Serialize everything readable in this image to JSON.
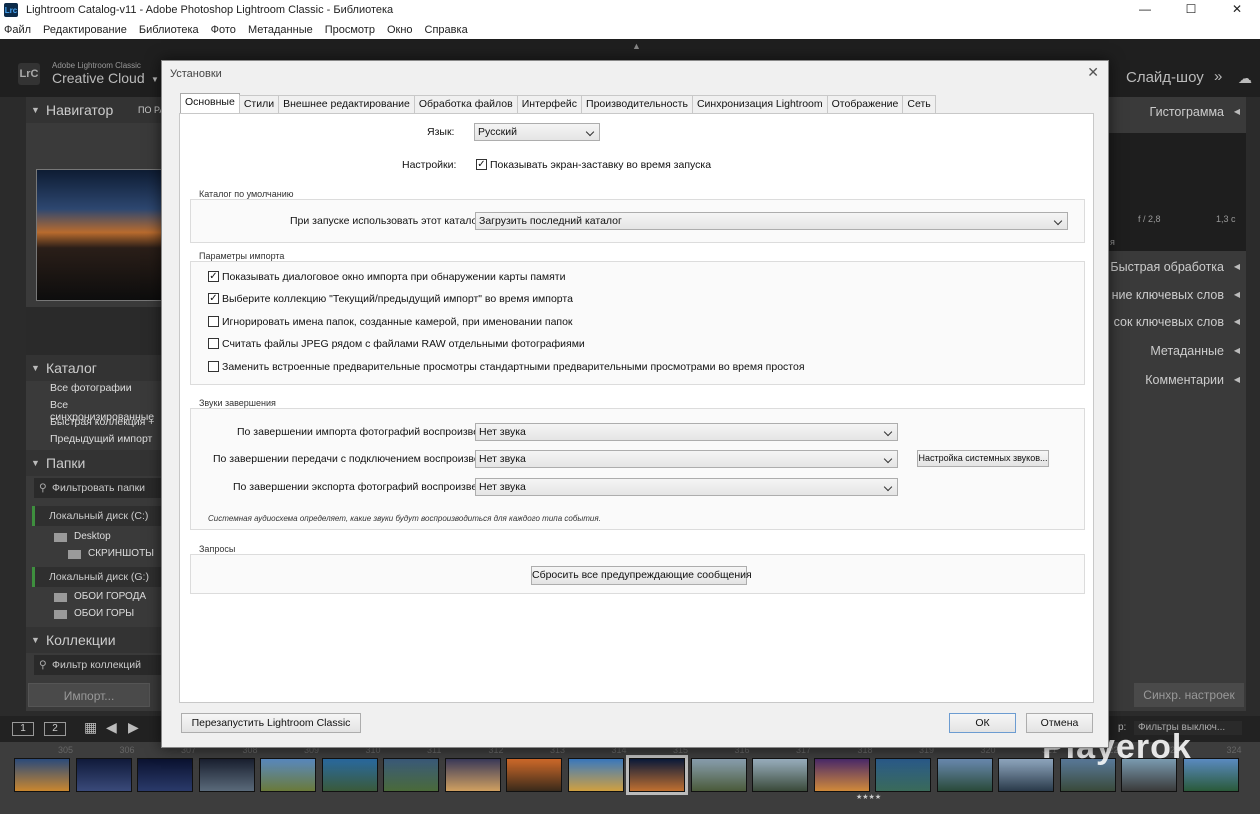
{
  "window": {
    "title": "Lightroom Catalog-v11 - Adobe Photoshop Lightroom Classic - Библиотека",
    "app_icon": "Lrc",
    "controls": [
      "—",
      "☐",
      "✕"
    ]
  },
  "menu": [
    "Файл",
    "Редактирование",
    "Библиотека",
    "Фото",
    "Метаданные",
    "Просмотр",
    "Окно",
    "Справка"
  ],
  "lr": {
    "logo": "LrC",
    "brand_small": "Adobe Lightroom Classic",
    "brand_big": "Creative Cloud",
    "module": "Слайд-шоу",
    "module_arrow": "»"
  },
  "left_panel": {
    "navigator": "Навигатор",
    "navigator_fit": "ПО РА",
    "catalog": "Каталог",
    "catalog_items": [
      "Все фотографии",
      "Все синхронизированные",
      "Быстрая коллекция  +",
      "Предыдущий импорт"
    ],
    "folders": "Папки",
    "folders_filter": "Фильтровать папки",
    "drive_c": "Локальный диск (C:)",
    "desktop": "Desktop",
    "screenshots": "СКРИНШОТЫ",
    "drive_g": "Локальный диск (G:)",
    "city": "ОБОИ ГОРОДА",
    "mountains": "ОБОИ ГОРЫ",
    "collections": "Коллекции",
    "collections_filter": "Фильтр коллекций",
    "import_btn": "Импорт..."
  },
  "right_panel": {
    "histogram": "Гистограмма",
    "aperture": "f / 2,8",
    "shutter": "1,3 с",
    "hist_caption": "я",
    "items": [
      "Быстрая обработка",
      "ние ключевых слов",
      "сок ключевых слов",
      "Метаданные",
      "Комментарии"
    ],
    "sync_btn": "Синхр. настроек",
    "filter_label": "р:",
    "filter_value": "Фильтры выключ..."
  },
  "filmstrip": {
    "page1": "1",
    "page2": "2",
    "numbers": [
      "305",
      "306",
      "307",
      "308",
      "309",
      "310",
      "311",
      "312",
      "313",
      "314",
      "315",
      "316",
      "317",
      "318",
      "319",
      "320",
      "321",
      "322",
      "323",
      "324"
    ],
    "stars": "★★★★",
    "watermark": "Playerok"
  },
  "dialog": {
    "title": "Установки",
    "close": "✕",
    "tabs": [
      "Основные",
      "Стили",
      "Внешнее редактирование",
      "Обработка файлов",
      "Интерфейс",
      "Производительность",
      "Синхронизация Lightroom",
      "Отображение",
      "Сеть"
    ],
    "language_label": "Язык:",
    "language_value": "Русский",
    "settings_label": "Настройки:",
    "splash_label": "Показывать экран-заставку во время запуска",
    "splash_checked": true,
    "default_catalog": {
      "title": "Каталог по умолчанию",
      "label": "При запуске использовать этот каталог:",
      "value": "Загрузить последний каталог"
    },
    "import": {
      "title": "Параметры импорта",
      "options": [
        {
          "label": "Показывать диалоговое окно импорта при обнаружении карты памяти",
          "checked": true
        },
        {
          "label": "Выберите коллекцию \"Текущий/предыдущий импорт\" во время импорта",
          "checked": true
        },
        {
          "label": "Игнорировать имена папок, созданные камерой, при именовании папок",
          "checked": false
        },
        {
          "label": "Считать файлы JPEG рядом с файлами RAW отдельными фотографиями",
          "checked": false
        },
        {
          "label": "Заменить встроенные предварительные просмотры стандартными предварительными просмотрами во время простоя",
          "checked": false
        }
      ]
    },
    "sounds": {
      "title": "Звуки завершения",
      "import_label": "По завершении импорта фотографий воспроизвести:",
      "import_value": "Нет звука",
      "tether_label": "По завершении передачи с подключением воспроизвести:",
      "tether_value": "Нет звука",
      "export_label": "По завершении экспорта фотографий воспроизвести:",
      "export_value": "Нет звука",
      "system_btn": "Настройка системных звуков...",
      "note": "Системная аудиосхема определяет, какие звуки будут воспроизводиться для каждого типа события."
    },
    "prompts": {
      "title": "Запросы",
      "reset_btn": "Сбросить все предупреждающие сообщения"
    },
    "restart_btn": "Перезапустить Lightroom Classic",
    "ok_btn": "ОК",
    "cancel_btn": "Отмена"
  }
}
